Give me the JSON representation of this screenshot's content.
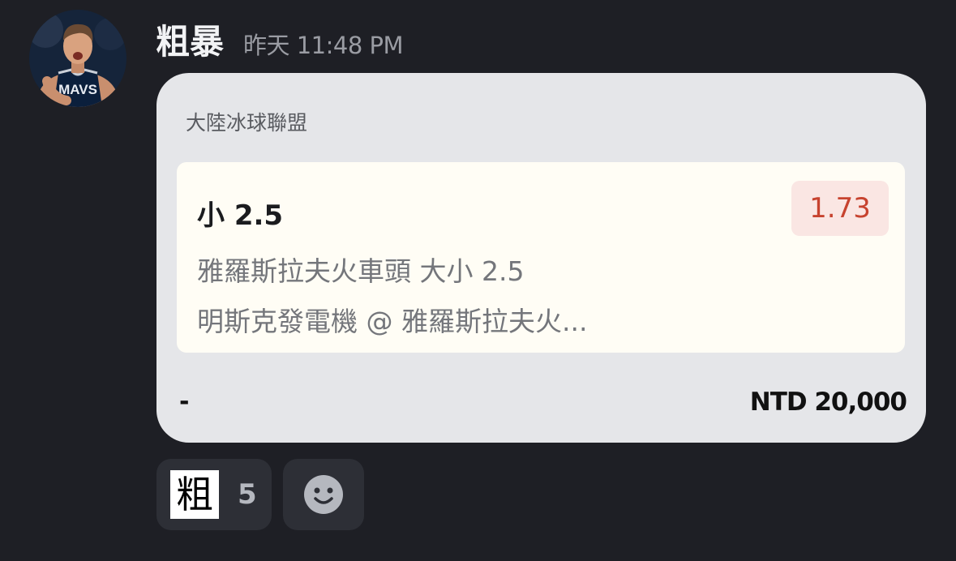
{
  "message": {
    "author": "粗暴",
    "timestamp": "昨天 11:48 PM",
    "avatar_icon": "user-avatar-basketball-player",
    "avatar_jersey_text": "MAVS"
  },
  "bet_card": {
    "league": "大陸冰球聯盟",
    "selection": "小 2.5",
    "odds": "1.73",
    "market": "雅羅斯拉夫火車頭 大小 2.5",
    "matchup": "明斯克發電機 @ 雅羅斯拉夫火...",
    "status": "-",
    "stake": "NTD 20,000"
  },
  "reactions": [
    {
      "emoji": "粗",
      "count": "5"
    }
  ],
  "add_reaction_icon": "smiley-face-icon"
}
